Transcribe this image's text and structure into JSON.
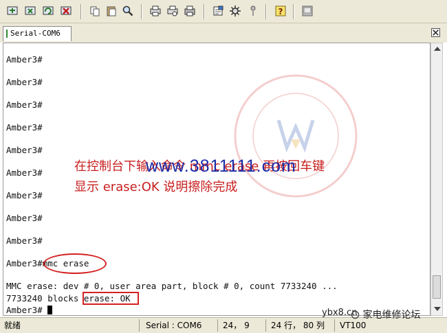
{
  "toolbar": {
    "buttons": [
      {
        "name": "connect-icon"
      },
      {
        "name": "quick-connect-icon"
      },
      {
        "name": "reconnect-icon"
      },
      {
        "name": "disconnect-icon"
      },
      {
        "name": "copy-icon"
      },
      {
        "name": "paste-icon"
      },
      {
        "name": "find-icon"
      },
      {
        "name": "print-setup-icon"
      },
      {
        "name": "print-preview-icon"
      },
      {
        "name": "print-icon"
      },
      {
        "name": "session-options-icon"
      },
      {
        "name": "global-options-icon"
      },
      {
        "name": "key-icon"
      },
      {
        "name": "help-icon"
      },
      {
        "name": "screen-icon"
      }
    ]
  },
  "tab": {
    "label": "Serial-COM6"
  },
  "terminal": {
    "lines": [
      "Amber3#",
      "Amber3#",
      "Amber3#",
      "Amber3#",
      "Amber3#",
      "Amber3#",
      "Amber3#",
      "Amber3#",
      "Amber3#",
      "Amber3# mmc erase",
      "MMC erase: dev # 0, user area part, block # 0, count 7733240 ...",
      "7733240 blocks erase: OK",
      "Amber3#"
    ],
    "prompt": "Amber3#",
    "command": "mmc erase",
    "erase_info": "MMC erase: dev # 0, user area part, block # 0, count 7733240 ...",
    "blocks": "7733240 blocks",
    "result": "erase: OK"
  },
  "annotation": {
    "line1": "在控制台下输入命令 mmc erase 再按回车键",
    "line2": "显示 erase:OK 说明擦除完成",
    "url": "www.3811111.com"
  },
  "statusbar": {
    "ready": "就绪",
    "connection": "Serial : COM6",
    "cursor_pos": "24， 9",
    "size": "24 行， 80 列",
    "terminal_type": "VT100"
  },
  "watermark": {
    "site": "ybx8.cn",
    "name": "家电维修论坛"
  },
  "colors": {
    "annotation": "#c81e1e",
    "url": "#1c2ca8",
    "highlight": "#d42020"
  }
}
